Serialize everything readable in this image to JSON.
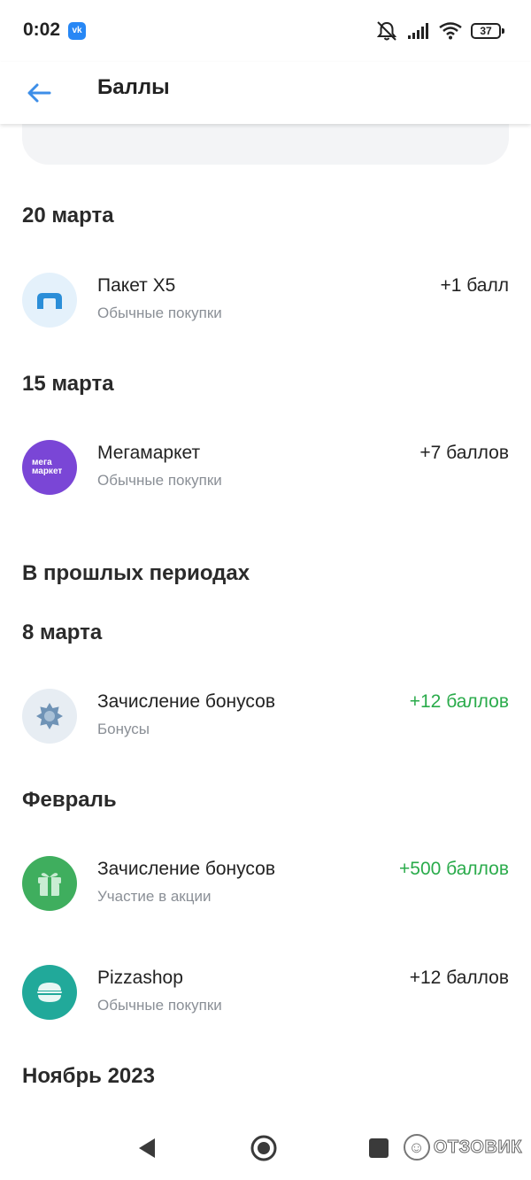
{
  "status_bar": {
    "time": "0:02",
    "app_badge": "vk",
    "icons": [
      "bell-muted-icon",
      "signal-icon",
      "wifi-icon"
    ],
    "battery": "37"
  },
  "header": {
    "back_icon": "arrow-left-icon",
    "title": "Баллы",
    "accent_color": "#3d8ee8"
  },
  "sections": [
    {
      "heading": "20 марта"
    },
    {
      "heading": "15 марта"
    },
    {
      "heading": "В прошлых периодах"
    },
    {
      "heading": "8 марта"
    },
    {
      "heading": "Февраль"
    },
    {
      "heading": "Ноябрь 2023"
    }
  ],
  "transactions": [
    {
      "title": "Пакет X5",
      "subtitle": "Обычные покупки",
      "amount": "+1 балл",
      "icon": "x5-package-icon"
    },
    {
      "title": "Мегамаркет",
      "subtitle": "Обычные покупки",
      "amount": "+7 баллов",
      "icon": "megamarket-logo",
      "logo_text": "мега маркет"
    },
    {
      "title": "Зачисление бонусов",
      "subtitle": "Бонусы",
      "amount": "+12 баллов",
      "icon": "badge-star-icon",
      "amount_color": "#2aab4b"
    },
    {
      "title": "Зачисление бонусов",
      "subtitle": "Участие в акции",
      "amount": "+500 баллов",
      "icon": "gift-icon",
      "amount_color": "#2aab4b"
    },
    {
      "title": "Pizzashop",
      "subtitle": "Обычные покупки",
      "amount": "+12 баллов",
      "icon": "pizzashop-burger-icon"
    }
  ],
  "nav": {
    "buttons": [
      "back-triangle-icon",
      "home-circle-icon",
      "recents-square-icon"
    ]
  },
  "watermark": {
    "text": "ОТЗОВИК"
  }
}
